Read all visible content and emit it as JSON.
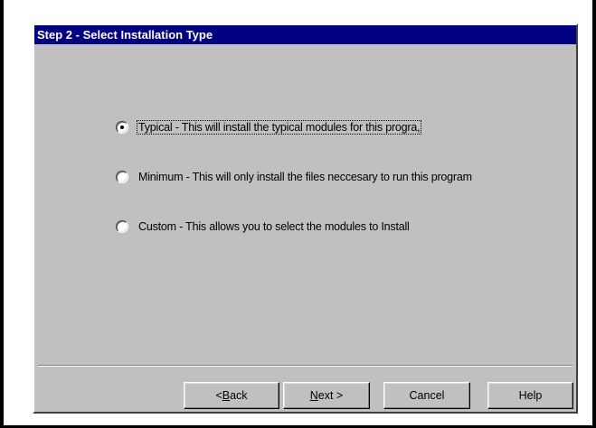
{
  "dialog": {
    "title": "Step 2 - Select Installation Type"
  },
  "options": [
    {
      "label": "Typical - This will install the typical modules for this progra,",
      "selected": true,
      "focused": true
    },
    {
      "label": "Minimum - This will only install the files neccesary to run this program",
      "selected": false,
      "focused": false
    },
    {
      "label": "Custom - This allows you to select the modules to Install",
      "selected": false,
      "focused": false
    }
  ],
  "buttons": {
    "back": {
      "prefix": "< ",
      "mnemonic": "B",
      "rest": "ack"
    },
    "next": {
      "prefix": "",
      "mnemonic": "N",
      "rest": "ext >"
    },
    "cancel": "Cancel",
    "help": "Help"
  },
  "colors": {
    "title_bar": "#000080",
    "dialog_face": "#c0c0c0"
  }
}
